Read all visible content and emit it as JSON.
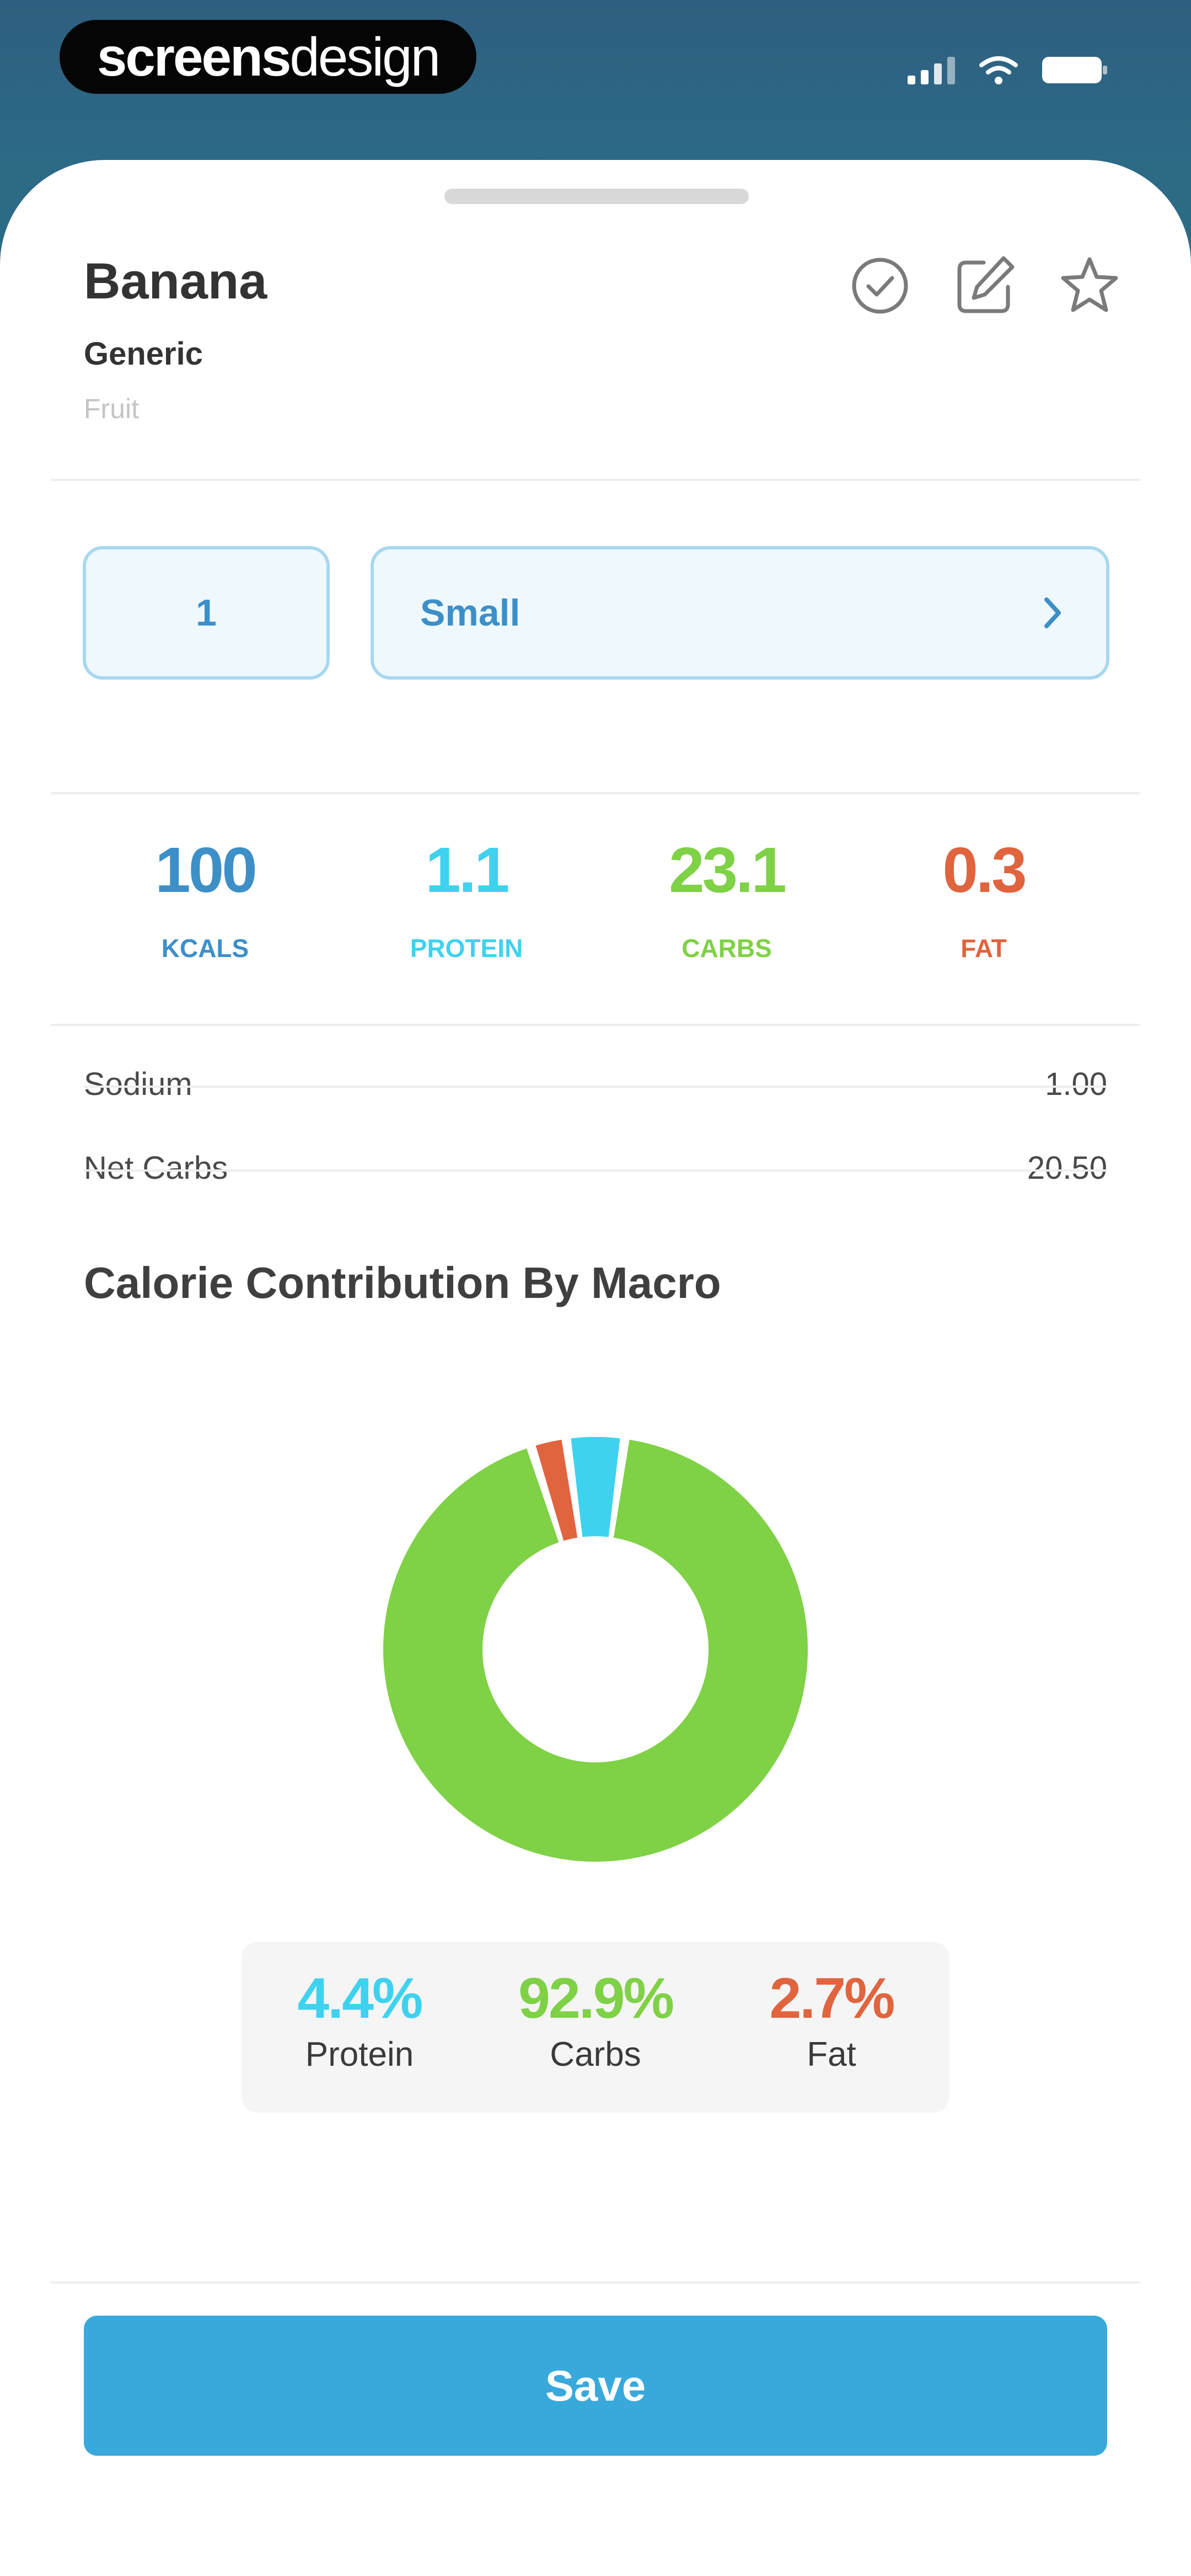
{
  "status_bar": {
    "brand_bold": "screens",
    "brand_light": "design",
    "icons": [
      "signal-icon",
      "wifi-icon",
      "battery-icon"
    ]
  },
  "food": {
    "title": "Banana",
    "brand": "Generic",
    "category": "Fruit"
  },
  "actions": [
    "check-circle-icon",
    "edit-icon",
    "star-icon"
  ],
  "serving": {
    "quantity": "1",
    "size": "Small"
  },
  "macros": [
    {
      "value": "100",
      "label": "KCALS",
      "color": "#3d8fc8"
    },
    {
      "value": "1.1",
      "label": "PROTEIN",
      "color": "#3fd2ef"
    },
    {
      "value": "23.1",
      "label": "CARBS",
      "color": "#7fd146"
    },
    {
      "value": "0.3",
      "label": "FAT",
      "color": "#e0643e"
    }
  ],
  "nutrients": [
    {
      "name": "Sodium",
      "value": "1.00"
    },
    {
      "name": "Net Carbs",
      "value": "20.50"
    }
  ],
  "chart_title": "Calorie Contribution By Macro",
  "chart_data": {
    "type": "pie",
    "categories": [
      "Protein",
      "Carbs",
      "Fat"
    ],
    "values": [
      4.4,
      92.9,
      2.7
    ],
    "colors": [
      "#3fd2ef",
      "#7fd146",
      "#e0643e"
    ],
    "title": "Calorie Contribution By Macro"
  },
  "percentages": [
    {
      "value": "4.4%",
      "name": "Protein",
      "color": "#3fd2ef"
    },
    {
      "value": "92.9%",
      "name": "Carbs",
      "color": "#7fd146"
    },
    {
      "value": "2.7%",
      "name": "Fat",
      "color": "#e0643e"
    }
  ],
  "save_label": "Save"
}
